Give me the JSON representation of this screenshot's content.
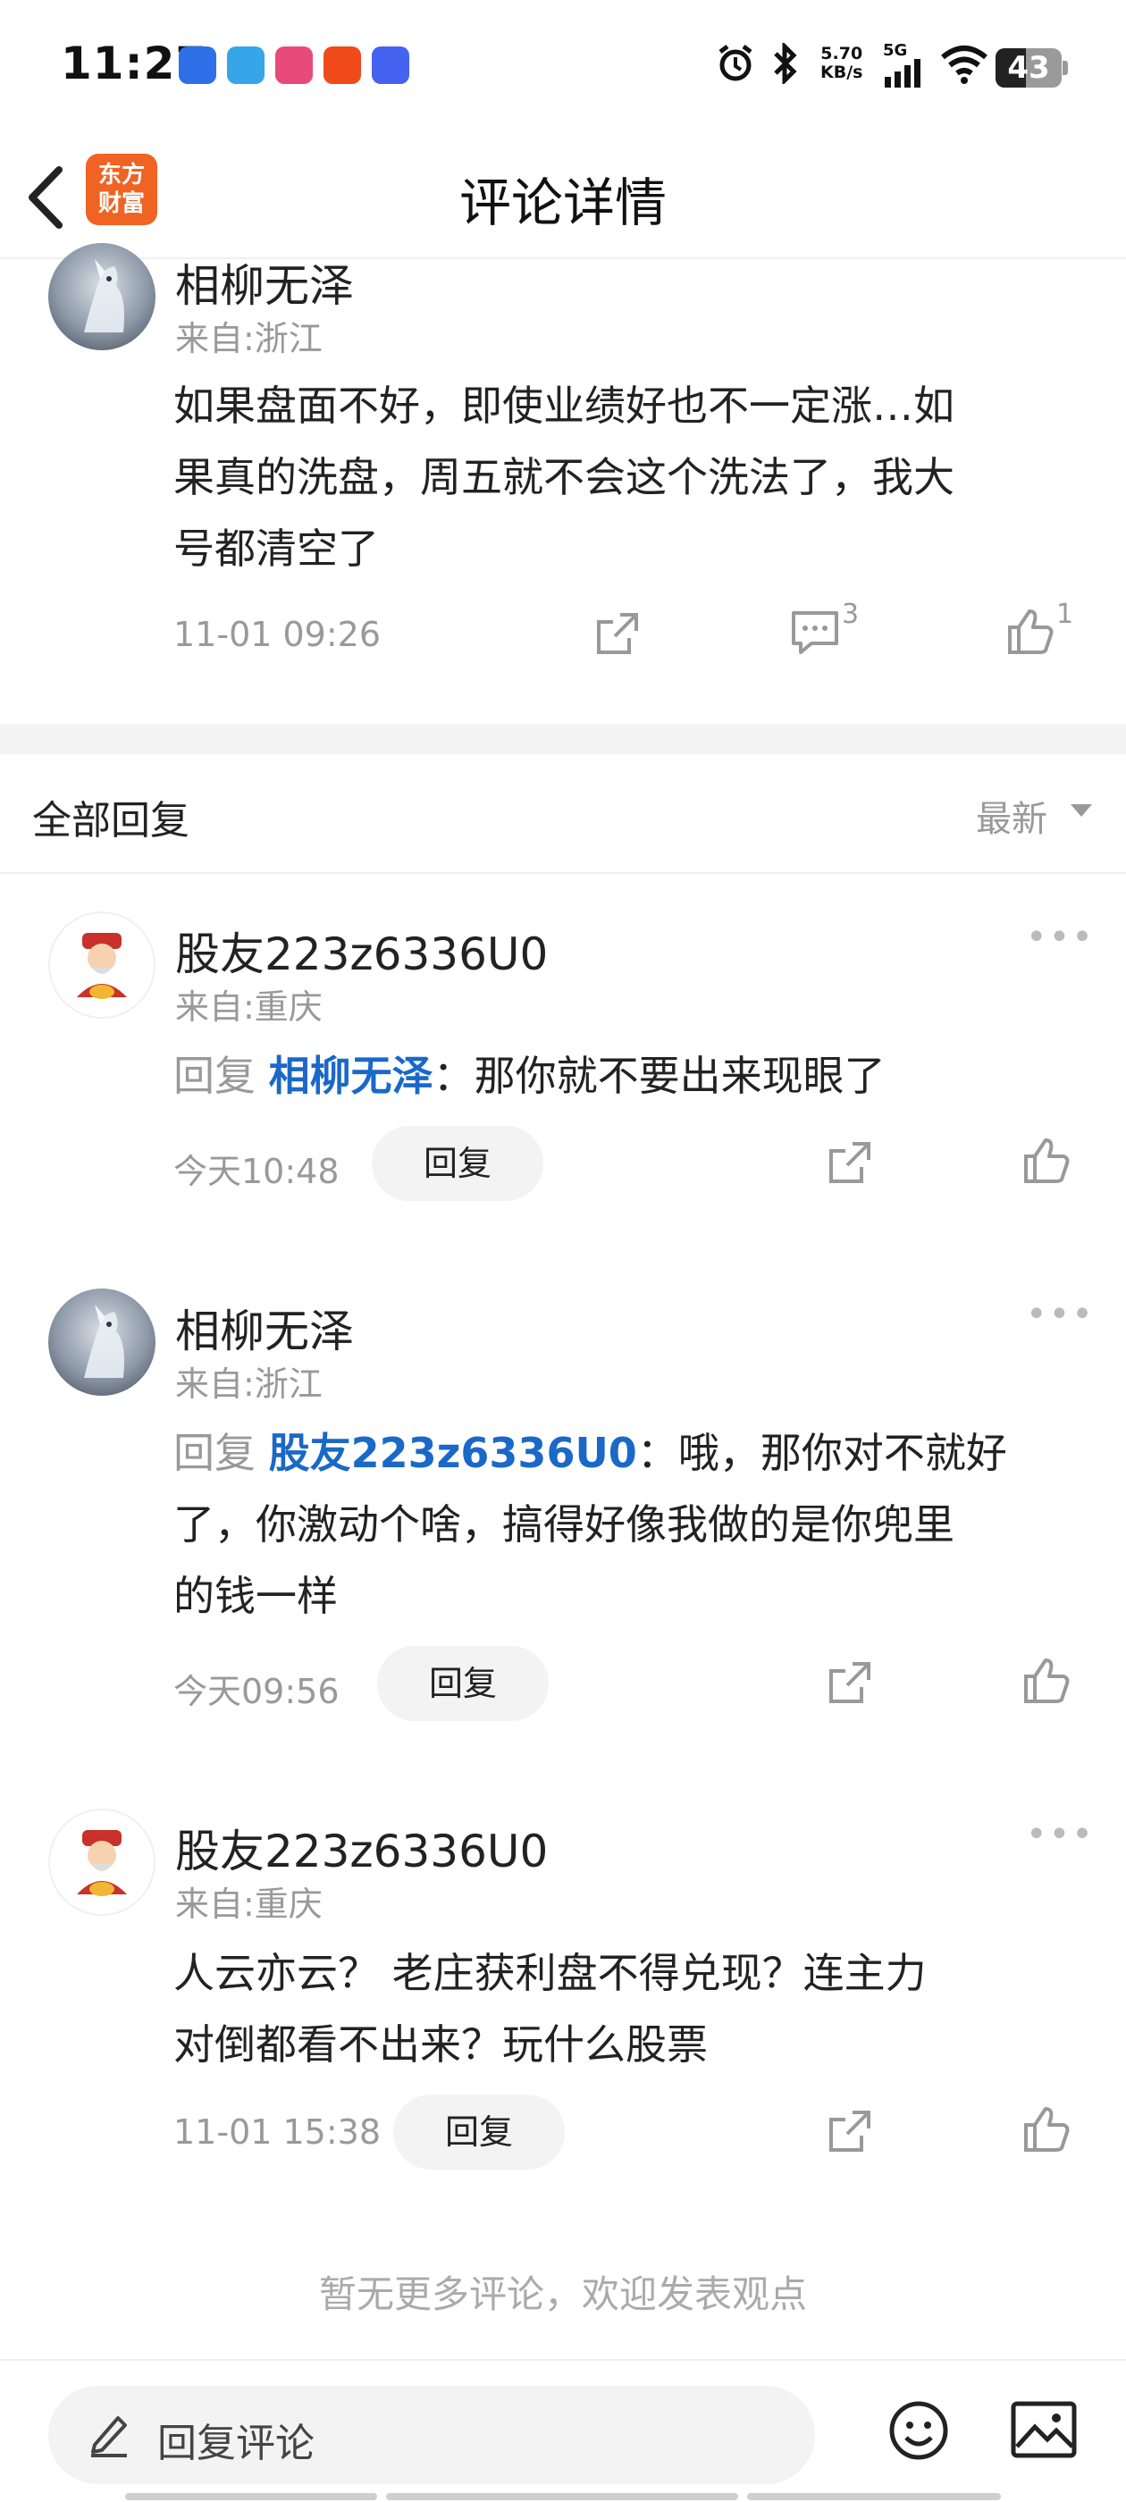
{
  "status_bar": {
    "time": "11:27",
    "net_speed_value": "5.70",
    "net_speed_unit": "KB/s",
    "signal_label": "5G",
    "battery": "43"
  },
  "header": {
    "title": "评论详情",
    "logo_line1": "东方",
    "logo_line2": "财富"
  },
  "main_comment": {
    "username": "相柳无泽",
    "region": "来自:浙江",
    "text_line1": "如果盘面不好，即使业绩好也不一定涨…如",
    "text_line2": "果真的洗盘，周五就不会这个洗法了，我大",
    "text_line3": "号都清空了",
    "time": "11-01 09:26",
    "comment_count": "3",
    "like_count": "1"
  },
  "replies_section": {
    "title": "全部回复",
    "sort_label": "最新"
  },
  "replies": [
    {
      "username": "股友223z6336U0",
      "region": "来自:重庆",
      "reply_prefix": "回复 ",
      "mention": "相柳无泽",
      "text_line1": "：那你就不要出来现眼了",
      "time": "今天10:48",
      "reply_label": "回复",
      "more": "•••"
    },
    {
      "username": "相柳无泽",
      "region": "来自:浙江",
      "reply_prefix": "回复 ",
      "mention": "股友223z6336U0",
      "text_line1": "：哦，那你对不就好",
      "text_line2": "了，你激动个啥，搞得好像我做的是你兜里",
      "text_line3": "的钱一样",
      "time": "今天09:56",
      "reply_label": "回复",
      "more": "•••"
    },
    {
      "username": "股友223z6336U0",
      "region": "来自:重庆",
      "text_line1": "人云亦云？ 老庄获利盘不得兑现？连主力",
      "text_line2": "对倒都看不出来？玩什么股票",
      "time": "11-01 15:38",
      "reply_label": "回复",
      "more": "•••"
    }
  ],
  "footer_note": "暂无更多评论，欢迎发表观点",
  "bottom_bar": {
    "input_placeholder": "回复评论"
  },
  "colors": {
    "accent_link": "#1a68c8",
    "brand_logo": "#f06322",
    "muted_text": "#999999"
  },
  "icons": [
    "back-arrow-icon",
    "share-icon",
    "comment-icon",
    "like-icon",
    "more-icon",
    "pencil-icon",
    "emoji-icon",
    "image-icon",
    "alarm-icon",
    "bluetooth-icon",
    "signal-icon",
    "wifi-icon"
  ]
}
